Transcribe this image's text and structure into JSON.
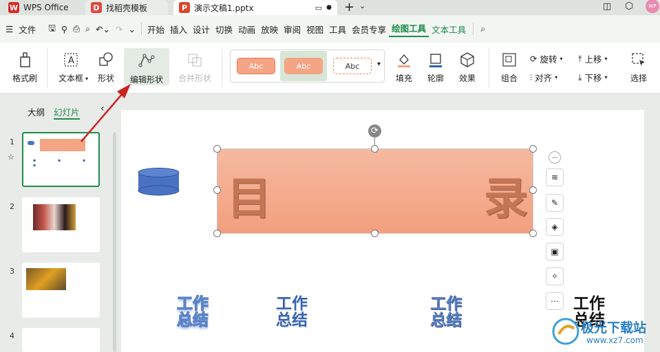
{
  "tabs": [
    {
      "label": "WPS Office",
      "icon": "wps-logo-icon"
    },
    {
      "label": "找稻壳模板",
      "icon": "docer-icon"
    },
    {
      "label": "演示文稿1.pptx",
      "icon": "ppt-icon"
    }
  ],
  "menu": {
    "file": "文件",
    "items": [
      "开始",
      "插入",
      "设计",
      "切换",
      "动画",
      "放映",
      "审阅",
      "视图",
      "工具",
      "会员专享",
      "绘图工具",
      "文本工具"
    ],
    "active": "绘图工具"
  },
  "ribbon": {
    "format_painter": "格式刷",
    "textbox": "文本框",
    "shape": "形状",
    "edit_shape": "编辑形状",
    "merge_shape": "合并形状",
    "style_samples": [
      "Abc",
      "Abc",
      "Abc"
    ],
    "fill": "填充",
    "outline": "轮廓",
    "effect": "效果",
    "group": "组合",
    "rotate": "旋转",
    "align": "对齐",
    "bring_forward": "上移",
    "send_backward": "下移",
    "select": "选择"
  },
  "panel": {
    "outline_tab": "大纲",
    "slides_tab": "幻灯片",
    "slide_numbers": [
      "1",
      "2",
      "3",
      "4"
    ]
  },
  "slide": {
    "title_left": "目",
    "title_right": "录",
    "items": [
      "工作\n总结",
      "工作\n总结",
      "工作\n总结",
      "工作\n总结"
    ]
  },
  "watermark": {
    "brand": "极光下载站",
    "url": "www.xz7.com"
  },
  "colors": {
    "accent": "#1f8b4c",
    "shape_fill": "#f3a585",
    "cylinder": "#4a72c4",
    "wordart_blue": "#3a63b0",
    "arrow": "#cc2222"
  }
}
